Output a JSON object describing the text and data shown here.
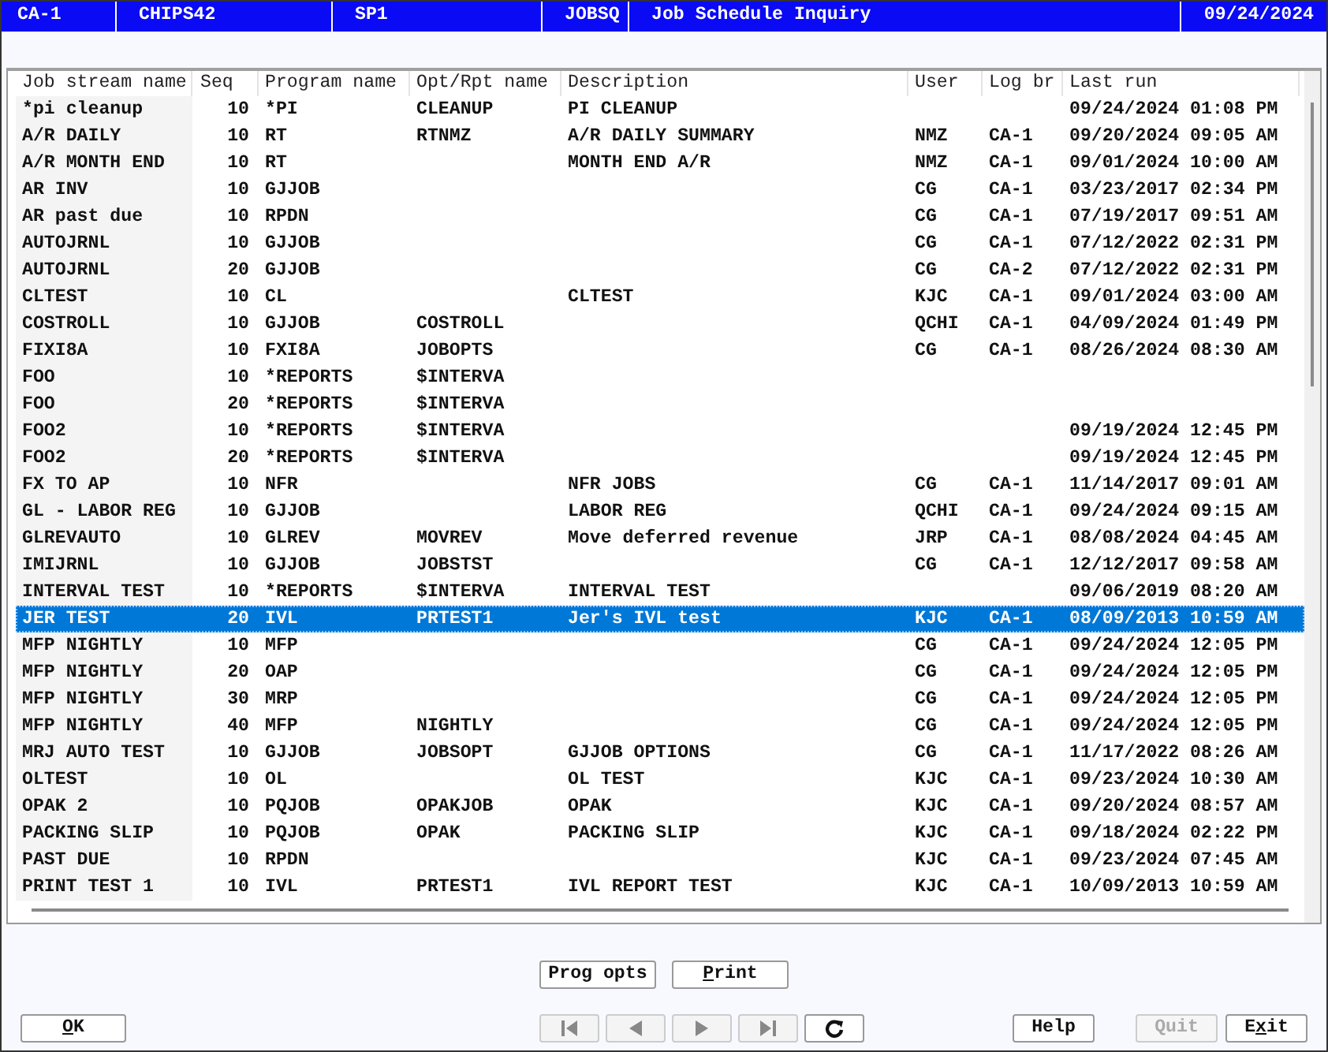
{
  "title_bar": {
    "segments": [
      "CA-1",
      "CHIPS42",
      "SP1",
      "JOBSQ",
      "Job Schedule Inquiry"
    ],
    "date": "09/24/2024"
  },
  "table": {
    "columns": [
      "Job stream name",
      "Seq",
      "Program name",
      "Opt/Rpt name",
      "Description",
      "User",
      "Log br",
      "Last run"
    ],
    "rows": [
      {
        "job": "*pi cleanup",
        "seq": "10",
        "program": "*PI",
        "opt": "CLEANUP",
        "description": "PI CLEANUP",
        "last_run": "09/24/2024 01:08 PM",
        "selected": false
      },
      {
        "job": "A/R DAILY",
        "seq": "10",
        "program": "RT",
        "opt": "RTNMZ",
        "description": "A/R DAILY SUMMARY",
        "user": "NMZ",
        "log_br": "CA-1",
        "last_run": "09/20/2024 09:05 AM",
        "selected": false
      },
      {
        "job": "A/R MONTH END",
        "seq": "10",
        "program": "RT",
        "description": "MONTH END A/R",
        "user": "NMZ",
        "log_br": "CA-1",
        "last_run": "09/01/2024 10:00 AM",
        "selected": false
      },
      {
        "job": "AR INV",
        "seq": "10",
        "program": "GJJOB",
        "user": "CG",
        "log_br": "CA-1",
        "last_run": "03/23/2017 02:34 PM",
        "selected": false
      },
      {
        "job": "AR past due",
        "seq": "10",
        "program": "RPDN",
        "user": "CG",
        "log_br": "CA-1",
        "last_run": "07/19/2017 09:51 AM",
        "selected": false
      },
      {
        "job": "AUTOJRNL",
        "seq": "10",
        "program": "GJJOB",
        "user": "CG",
        "log_br": "CA-1",
        "last_run": "07/12/2022 02:31 PM",
        "selected": false
      },
      {
        "job": "AUTOJRNL",
        "seq": "20",
        "program": "GJJOB",
        "user": "CG",
        "log_br": "CA-2",
        "last_run": "07/12/2022 02:31 PM",
        "selected": false
      },
      {
        "job": "CLTEST",
        "seq": "10",
        "program": "CL",
        "description": "CLTEST",
        "user": "KJC",
        "log_br": "CA-1",
        "last_run": "09/01/2024 03:00 AM",
        "selected": false
      },
      {
        "job": "COSTROLL",
        "seq": "10",
        "program": "GJJOB",
        "opt": "COSTROLL",
        "user": "QCHI",
        "log_br": "CA-1",
        "last_run": "04/09/2024 01:49 PM",
        "selected": false
      },
      {
        "job": "FIXI8A",
        "seq": "10",
        "program": "FXI8A",
        "opt": "JOBOPTS",
        "user": "CG",
        "log_br": "CA-1",
        "last_run": "08/26/2024 08:30 AM",
        "selected": false
      },
      {
        "job": "FOO",
        "seq": "10",
        "program": "*REPORTS",
        "opt": "$INTERVA",
        "selected": false
      },
      {
        "job": "FOO",
        "seq": "20",
        "program": "*REPORTS",
        "opt": "$INTERVA",
        "selected": false
      },
      {
        "job": "FOO2",
        "seq": "10",
        "program": "*REPORTS",
        "opt": "$INTERVA",
        "last_run": "09/19/2024 12:45 PM",
        "selected": false
      },
      {
        "job": "FOO2",
        "seq": "20",
        "program": "*REPORTS",
        "opt": "$INTERVA",
        "last_run": "09/19/2024 12:45 PM",
        "selected": false
      },
      {
        "job": "FX TO AP",
        "seq": "10",
        "program": "NFR",
        "description": "NFR JOBS",
        "user": "CG",
        "log_br": "CA-1",
        "last_run": "11/14/2017 09:01 AM",
        "selected": false
      },
      {
        "job": "GL - LABOR REG",
        "seq": "10",
        "program": "GJJOB",
        "description": "LABOR REG",
        "user": "QCHI",
        "log_br": "CA-1",
        "last_run": "09/24/2024 09:15 AM",
        "selected": false
      },
      {
        "job": "GLREVAUTO",
        "seq": "10",
        "program": "GLREV",
        "opt": "MOVREV",
        "description": "Move deferred revenue",
        "user": "JRP",
        "log_br": "CA-1",
        "last_run": "08/08/2024 04:45 AM",
        "selected": false
      },
      {
        "job": "IMIJRNL",
        "seq": "10",
        "program": "GJJOB",
        "opt": "JOBSTST",
        "user": "CG",
        "log_br": "CA-1",
        "last_run": "12/12/2017 09:58 AM",
        "selected": false
      },
      {
        "job": "INTERVAL TEST",
        "seq": "10",
        "program": "*REPORTS",
        "opt": "$INTERVA",
        "description": "INTERVAL TEST",
        "last_run": "09/06/2019 08:20 AM",
        "selected": false
      },
      {
        "job": "JER TEST",
        "seq": "20",
        "program": "IVL",
        "opt": "PRTEST1",
        "description": "Jer's IVL test",
        "user": "KJC",
        "log_br": "CA-1",
        "last_run": "08/09/2013 10:59 AM",
        "selected": true
      },
      {
        "job": "MFP NIGHTLY",
        "seq": "10",
        "program": "MFP",
        "user": "CG",
        "log_br": "CA-1",
        "last_run": "09/24/2024 12:05 PM",
        "selected": false
      },
      {
        "job": "MFP NIGHTLY",
        "seq": "20",
        "program": "OAP",
        "user": "CG",
        "log_br": "CA-1",
        "last_run": "09/24/2024 12:05 PM",
        "selected": false
      },
      {
        "job": "MFP NIGHTLY",
        "seq": "30",
        "program": "MRP",
        "user": "CG",
        "log_br": "CA-1",
        "last_run": "09/24/2024 12:05 PM",
        "selected": false
      },
      {
        "job": "MFP NIGHTLY",
        "seq": "40",
        "program": "MFP",
        "opt": "NIGHTLY",
        "user": "CG",
        "log_br": "CA-1",
        "last_run": "09/24/2024 12:05 PM",
        "selected": false
      },
      {
        "job": "MRJ AUTO TEST",
        "seq": "10",
        "program": "GJJOB",
        "opt": "JOBSOPT",
        "description": "GJJOB OPTIONS",
        "user": "CG",
        "log_br": "CA-1",
        "last_run": "11/17/2022 08:26 AM",
        "selected": false
      },
      {
        "job": "OLTEST",
        "seq": "10",
        "program": "OL",
        "description": "OL TEST",
        "user": "KJC",
        "log_br": "CA-1",
        "last_run": "09/23/2024 10:30 AM",
        "selected": false
      },
      {
        "job": "OPAK 2",
        "seq": "10",
        "program": "PQJOB",
        "opt": "OPAKJOB",
        "description": "OPAK",
        "user": "KJC",
        "log_br": "CA-1",
        "last_run": "09/20/2024 08:57 AM",
        "selected": false
      },
      {
        "job": "PACKING SLIP",
        "seq": "10",
        "program": "PQJOB",
        "opt": "OPAK",
        "description": "PACKING SLIP",
        "user": "KJC",
        "log_br": "CA-1",
        "last_run": "09/18/2024 02:22 PM",
        "selected": false
      },
      {
        "job": "PAST DUE",
        "seq": "10",
        "program": "RPDN",
        "user": "KJC",
        "log_br": "CA-1",
        "last_run": "09/23/2024 07:45 AM",
        "selected": false
      },
      {
        "job": "PRINT TEST 1",
        "seq": "10",
        "program": "IVL",
        "opt": "PRTEST1",
        "description": "IVL REPORT TEST",
        "user": "KJC",
        "log_br": "CA-1",
        "last_run": "10/09/2013 10:59 AM",
        "selected": false
      }
    ]
  },
  "action_buttons": [
    {
      "before": "Pro",
      "key": "g",
      "after": " opts"
    },
    {
      "key": "P",
      "after": "rint"
    }
  ],
  "footer": {
    "ok": {
      "key": "O",
      "after": "K"
    },
    "nav_buttons": [
      {
        "kind": "first",
        "disabled": true
      },
      {
        "kind": "prev",
        "disabled": true
      },
      {
        "kind": "next",
        "disabled": true
      },
      {
        "kind": "last",
        "disabled": true
      },
      {
        "kind": "refresh",
        "disabled": false
      }
    ],
    "right_buttons": [
      {
        "before": "Help",
        "disabled": false
      },
      {
        "before": "Quit",
        "disabled": true
      },
      {
        "before": "E",
        "key": "x",
        "after": "it",
        "disabled": false
      }
    ]
  }
}
